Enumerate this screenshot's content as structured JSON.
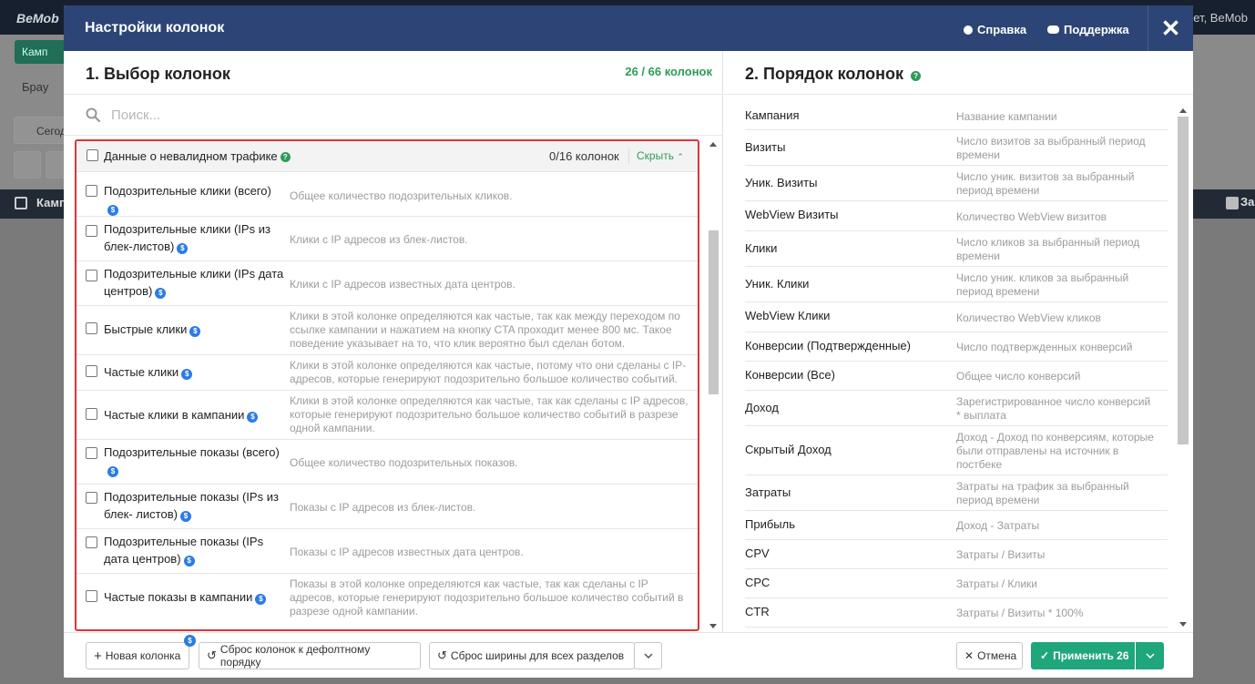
{
  "background": {
    "logo": "BeMob",
    "user": "ет, BeMob",
    "btn_text": "Камп",
    "text1": "Брау",
    "date_text": "Сегод",
    "header_col1": "Камп",
    "header_col_right": "За"
  },
  "modal": {
    "title": "Настройки колонок",
    "help_label": "Справка",
    "support_label": "Поддержка",
    "close_label": "✕"
  },
  "left": {
    "title": "1. Выбор колонок",
    "count": "26 / 66 колонок",
    "search_placeholder": "Поиск...",
    "group": {
      "label": "Данные о невалидном трафике",
      "count": "0/16 колонок",
      "hide_label": "Скрыть"
    },
    "items": [
      {
        "name": "Подозрительные клики (всего)",
        "desc": "Общее количество подозрительных кликов."
      },
      {
        "name": "Подозрительные клики (IPs из блек-листов)",
        "desc": "Клики с IP адресов из блек-листов."
      },
      {
        "name": "Подозрительные клики (IPs дата центров)",
        "desc": "Клики с IP адресов известных дата центров."
      },
      {
        "name": "Быстрые клики",
        "desc": "Клики в этой колонке определяются как частые, так как между переходом по ссылке кампании и нажатием на кнопку CTA проходит менее 800 мс. Такое поведение указывает на то, что клик вероятно был сделан ботом."
      },
      {
        "name": "Частые клики",
        "desc": "Клики в этой колонке определяются как частые, потому что они сделаны с IP-адресов, которые генерируют подозрительно большое количество событий."
      },
      {
        "name": "Частые клики в кампании",
        "desc": "Клики в этой колонке определяются как частые, так как сделаны с IP адресов, которые генерируют подозрительно большое количество событий в разрезе одной кампании."
      },
      {
        "name": "Подозрительные показы (всего)",
        "desc": "Общее количество подозрительных показов."
      },
      {
        "name": "Подозрительные показы (IPs из блек- листов)",
        "desc": "Показы с IP адресов из блек-листов."
      },
      {
        "name": "Подозрительные показы (IPs дата центров)",
        "desc": "Показы с IP адресов известных дата центров."
      },
      {
        "name": "Частые показы в кампании",
        "desc": "Показы в этой колонке определяются как частые, так как сделаны с IP адресов, которые генерируют подозрительно большое количество событий в разрезе одной кампании."
      }
    ]
  },
  "right": {
    "title": "2. Порядок колонок",
    "rows": [
      {
        "name": "Кампания",
        "desc": "Название кампании"
      },
      {
        "name": "Визиты",
        "desc": "Число визитов за выбранный период времени"
      },
      {
        "name": "Уник. Визиты",
        "desc": "Число уник. визитов за выбранный период времени"
      },
      {
        "name": "WebView Визиты",
        "desc": "Количество WebView визитов"
      },
      {
        "name": "Клики",
        "desc": "Число кликов за выбранный период времени"
      },
      {
        "name": "Уник. Клики",
        "desc": "Число уник. кликов за выбранный период времени"
      },
      {
        "name": "WebView Клики",
        "desc": "Количество WebView кликов"
      },
      {
        "name": "Конверсии (Подтвержденные)",
        "desc": "Число подтвержденных конверсий"
      },
      {
        "name": "Конверсии (Все)",
        "desc": "Общее число конверсий"
      },
      {
        "name": "Доход",
        "desc": "Зарегистрированное число конверсий * выплата"
      },
      {
        "name": "Скрытый Доход",
        "desc": "Доход - Доход по конверсиям, которые были отправлены на источник в постбеке"
      },
      {
        "name": "Затраты",
        "desc": "Затраты на трафик за выбранный период времени"
      },
      {
        "name": "Прибыль",
        "desc": "Доход - Затраты"
      },
      {
        "name": "CPV",
        "desc": "Затраты / Визиты"
      },
      {
        "name": "CPC",
        "desc": "Затраты / Клики"
      },
      {
        "name": "CTR",
        "desc": "Затраты / Визиты * 100%"
      }
    ]
  },
  "footer": {
    "new_column": "Новая колонка",
    "reset_order": "Сброс колонок к дефолтному порядку",
    "reset_width": "Сброс ширины для всех разделов",
    "cancel": "Отмена",
    "apply": "Применить 26",
    "new_badge": "$"
  }
}
